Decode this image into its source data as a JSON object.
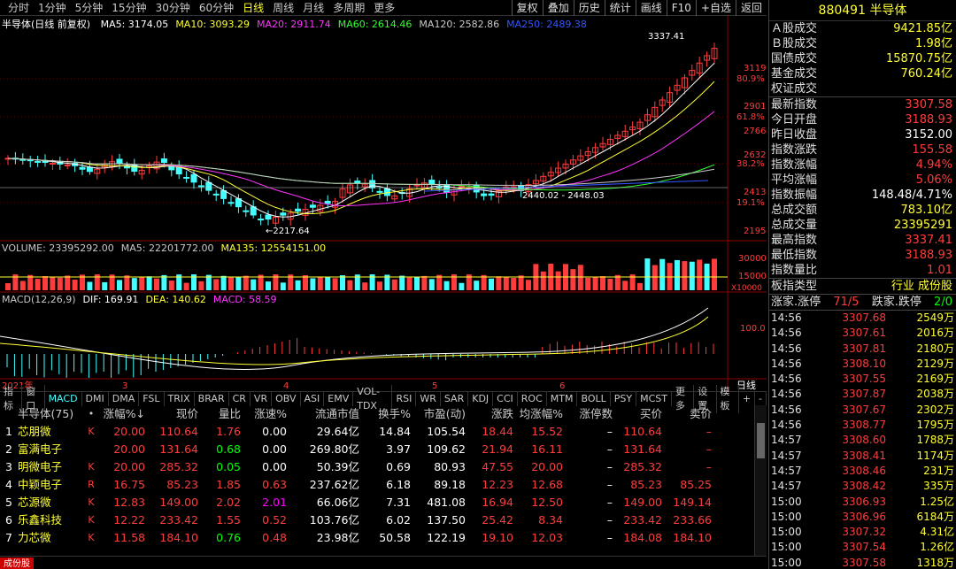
{
  "toolbar": {
    "periods": [
      "分时",
      "1分钟",
      "5分钟",
      "15分钟",
      "30分钟",
      "60分钟",
      "日线",
      "周线",
      "月线",
      "多周期",
      "更多"
    ],
    "active_period": "日线",
    "tools": [
      "复权",
      "叠加",
      "历史",
      "统计",
      "画线",
      "F10",
      "+自选",
      "返回"
    ]
  },
  "chart": {
    "title": "半导体(日线 前复权)",
    "ma_legend": [
      {
        "label": "MA5: 3174.05",
        "color": "#ffffff"
      },
      {
        "label": "MA10: 3093.29",
        "color": "#ffff33"
      },
      {
        "label": "MA20: 2911.74",
        "color": "#ff33ff"
      },
      {
        "label": "MA60: 2614.46",
        "color": "#33ff33"
      },
      {
        "label": "MA120: 2582.86",
        "color": "#c8c8c8"
      },
      {
        "label": "MA250: 2489.38",
        "color": "#3355ff"
      }
    ],
    "price_axis": [
      "3119",
      "2901",
      "2766",
      "2632",
      "2413",
      "2195"
    ],
    "pct_axis": [
      "80.9%",
      "61.8%",
      "38.2%",
      "19.1%"
    ],
    "high_label": "3337.41",
    "low_label": "2217.64",
    "mid_label": "2440.02 - 2448.03",
    "month_labels": [
      "2021年",
      "3",
      "4",
      "5",
      "6"
    ],
    "zoom_label": "日线"
  },
  "volume": {
    "legend": [
      {
        "label": "VOLUME: 23395292.00",
        "color": "#c8c8c8"
      },
      {
        "label": "MA5: 22201772.00",
        "color": "#c8c8c8"
      },
      {
        "label": "MA135: 12554151.00",
        "color": "#ffff33"
      }
    ],
    "axis": [
      "30000",
      "15000"
    ],
    "unit": "X10000"
  },
  "macd": {
    "legend": [
      {
        "label": "MACD(12,26,9)",
        "color": "#c8c8c8"
      },
      {
        "label": "DIF: 169.91",
        "color": "#ffffff"
      },
      {
        "label": "DEA: 140.62",
        "color": "#ffff33"
      },
      {
        "label": "MACD: 58.59",
        "color": "#ff33ff"
      }
    ],
    "axis": [
      "100.0"
    ]
  },
  "ind_tabs": [
    "指标",
    "窗口",
    "MACD",
    "DMI",
    "DMA",
    "FSL",
    "TRIX",
    "BRAR",
    "CR",
    "VR",
    "OBV",
    "ASI",
    "EMV",
    "VOL-TDX",
    "RSI",
    "WR",
    "SAR",
    "KDJ",
    "CCI",
    "ROC",
    "MTM",
    "BOLL",
    "PSY",
    "MCST",
    "更多",
    "设置",
    "模板",
    "+",
    "-"
  ],
  "ind_active": "MACD",
  "table": {
    "headers": [
      "",
      "半导体(75)",
      "•",
      "涨幅%↓",
      "现价",
      "量比",
      "涨速%",
      "流通市值",
      "换手%",
      "市盈(动)",
      "涨跌",
      "均涨幅%",
      "涨停数",
      "买价",
      "卖价"
    ],
    "rows": [
      {
        "n": "1",
        "name": "芯朋微",
        "flag": "K",
        "chg": "20.00",
        "price": "110.64",
        "vr": "1.76",
        "spd": "0.00",
        "cap": "29.64亿",
        "to": "14.84",
        "pe": "105.54",
        "diff": "18.44",
        "avg": "15.52",
        "lim": "–",
        "bid": "110.64",
        "ask": "–"
      },
      {
        "n": "2",
        "name": "富满电子",
        "flag": "",
        "chg": "20.00",
        "price": "131.64",
        "vr": "0.68",
        "spd": "0.00",
        "cap": "269.80亿",
        "to": "3.97",
        "pe": "109.62",
        "diff": "21.94",
        "avg": "16.11",
        "lim": "–",
        "bid": "131.64",
        "ask": "–"
      },
      {
        "n": "3",
        "name": "明微电子",
        "flag": "K",
        "chg": "20.00",
        "price": "285.32",
        "vr": "0.05",
        "spd": "0.00",
        "cap": "50.39亿",
        "to": "0.69",
        "pe": "80.93",
        "diff": "47.55",
        "avg": "20.00",
        "lim": "–",
        "bid": "285.32",
        "ask": "–"
      },
      {
        "n": "4",
        "name": "中颖电子",
        "flag": "R",
        "chg": "16.75",
        "price": "85.23",
        "vr": "1.85",
        "spd": "0.63",
        "cap": "237.62亿",
        "to": "6.18",
        "pe": "89.18",
        "diff": "12.23",
        "avg": "12.68",
        "lim": "–",
        "bid": "85.23",
        "ask": "85.25"
      },
      {
        "n": "5",
        "name": "芯源微",
        "flag": "K",
        "chg": "12.83",
        "price": "149.00",
        "vr": "2.02",
        "spd": "2.01",
        "cap": "66.06亿",
        "to": "7.31",
        "pe": "481.08",
        "diff": "16.94",
        "avg": "12.50",
        "lim": "–",
        "bid": "149.00",
        "ask": "149.14"
      },
      {
        "n": "6",
        "name": "乐鑫科技",
        "flag": "K",
        "chg": "12.22",
        "price": "233.42",
        "vr": "1.55",
        "spd": "0.52",
        "cap": "103.76亿",
        "to": "6.02",
        "pe": "137.50",
        "diff": "25.42",
        "avg": "8.34",
        "lim": "–",
        "bid": "233.42",
        "ask": "233.66"
      },
      {
        "n": "7",
        "name": "力芯微",
        "flag": "K",
        "chg": "11.58",
        "price": "184.10",
        "vr": "0.76",
        "spd": "0.48",
        "cap": "23.98亿",
        "to": "50.58",
        "pe": "122.19",
        "diff": "19.10",
        "avg": "12.03",
        "lim": "–",
        "bid": "184.08",
        "ask": "184.10"
      }
    ]
  },
  "status_tag": "成份股",
  "right_panel": {
    "title": "880491 半导体",
    "block1": [
      {
        "label": "Ａ股成交",
        "value": "9421.85亿",
        "color": "yellow"
      },
      {
        "label": "Ｂ股成交",
        "value": "1.98亿",
        "color": "yellow"
      },
      {
        "label": "国债成交",
        "value": "15870.75亿",
        "color": "yellow"
      },
      {
        "label": "基金成交",
        "value": "760.24亿",
        "color": "yellow"
      },
      {
        "label": "权证成交",
        "value": "",
        "color": "yellow"
      }
    ],
    "block2": [
      {
        "label": "最新指数",
        "value": "3307.58",
        "color": "red"
      },
      {
        "label": "今日开盘",
        "value": "3188.93",
        "color": "red"
      },
      {
        "label": "昨日收盘",
        "value": "3152.00",
        "color": "white"
      },
      {
        "label": "指数涨跌",
        "value": "155.58",
        "color": "red"
      },
      {
        "label": "指数涨幅",
        "value": "4.94%",
        "color": "red"
      },
      {
        "label": "平均涨幅",
        "value": "5.06%",
        "color": "red"
      },
      {
        "label": "指数振幅",
        "value": "148.48/4.71%",
        "color": "white"
      },
      {
        "label": "总成交额",
        "value": "783.10亿",
        "color": "yellow"
      },
      {
        "label": "总成交量",
        "value": "23395291",
        "color": "yellow"
      },
      {
        "label": "最高指数",
        "value": "3337.41",
        "color": "red"
      },
      {
        "label": "最低指数",
        "value": "3188.93",
        "color": "red"
      },
      {
        "label": "指数量比",
        "value": "1.01",
        "color": "red"
      }
    ],
    "board_type_label": "板指类型",
    "board_type_value": "行业 成份股",
    "up_label": "涨家.涨停",
    "up_value": "71/5",
    "down_label": "跌家.跌停",
    "down_value": "2/0",
    "ticks": [
      {
        "t": "14:56",
        "p": "3307.68",
        "v": "2549万"
      },
      {
        "t": "14:56",
        "p": "3307.61",
        "v": "2016万"
      },
      {
        "t": "14:56",
        "p": "3307.81",
        "v": "2180万"
      },
      {
        "t": "14:56",
        "p": "3308.10",
        "v": "2129万"
      },
      {
        "t": "14:56",
        "p": "3307.55",
        "v": "2169万"
      },
      {
        "t": "14:56",
        "p": "3307.87",
        "v": "2038万"
      },
      {
        "t": "14:56",
        "p": "3307.67",
        "v": "2302万"
      },
      {
        "t": "14:56",
        "p": "3308.77",
        "v": "1795万"
      },
      {
        "t": "14:57",
        "p": "3308.60",
        "v": "1788万"
      },
      {
        "t": "14:57",
        "p": "3308.41",
        "v": "1174万"
      },
      {
        "t": "14:57",
        "p": "3308.46",
        "v": "231万"
      },
      {
        "t": "14:57",
        "p": "3308.42",
        "v": "335万"
      },
      {
        "t": "15:00",
        "p": "3306.93",
        "v": "1.25亿"
      },
      {
        "t": "15:00",
        "p": "3306.96",
        "v": "6184万"
      },
      {
        "t": "15:00",
        "p": "3307.32",
        "v": "4.31亿"
      },
      {
        "t": "15:00",
        "p": "3307.54",
        "v": "1.26亿"
      },
      {
        "t": "15:00",
        "p": "3307.58",
        "v": "1318万"
      }
    ]
  }
}
